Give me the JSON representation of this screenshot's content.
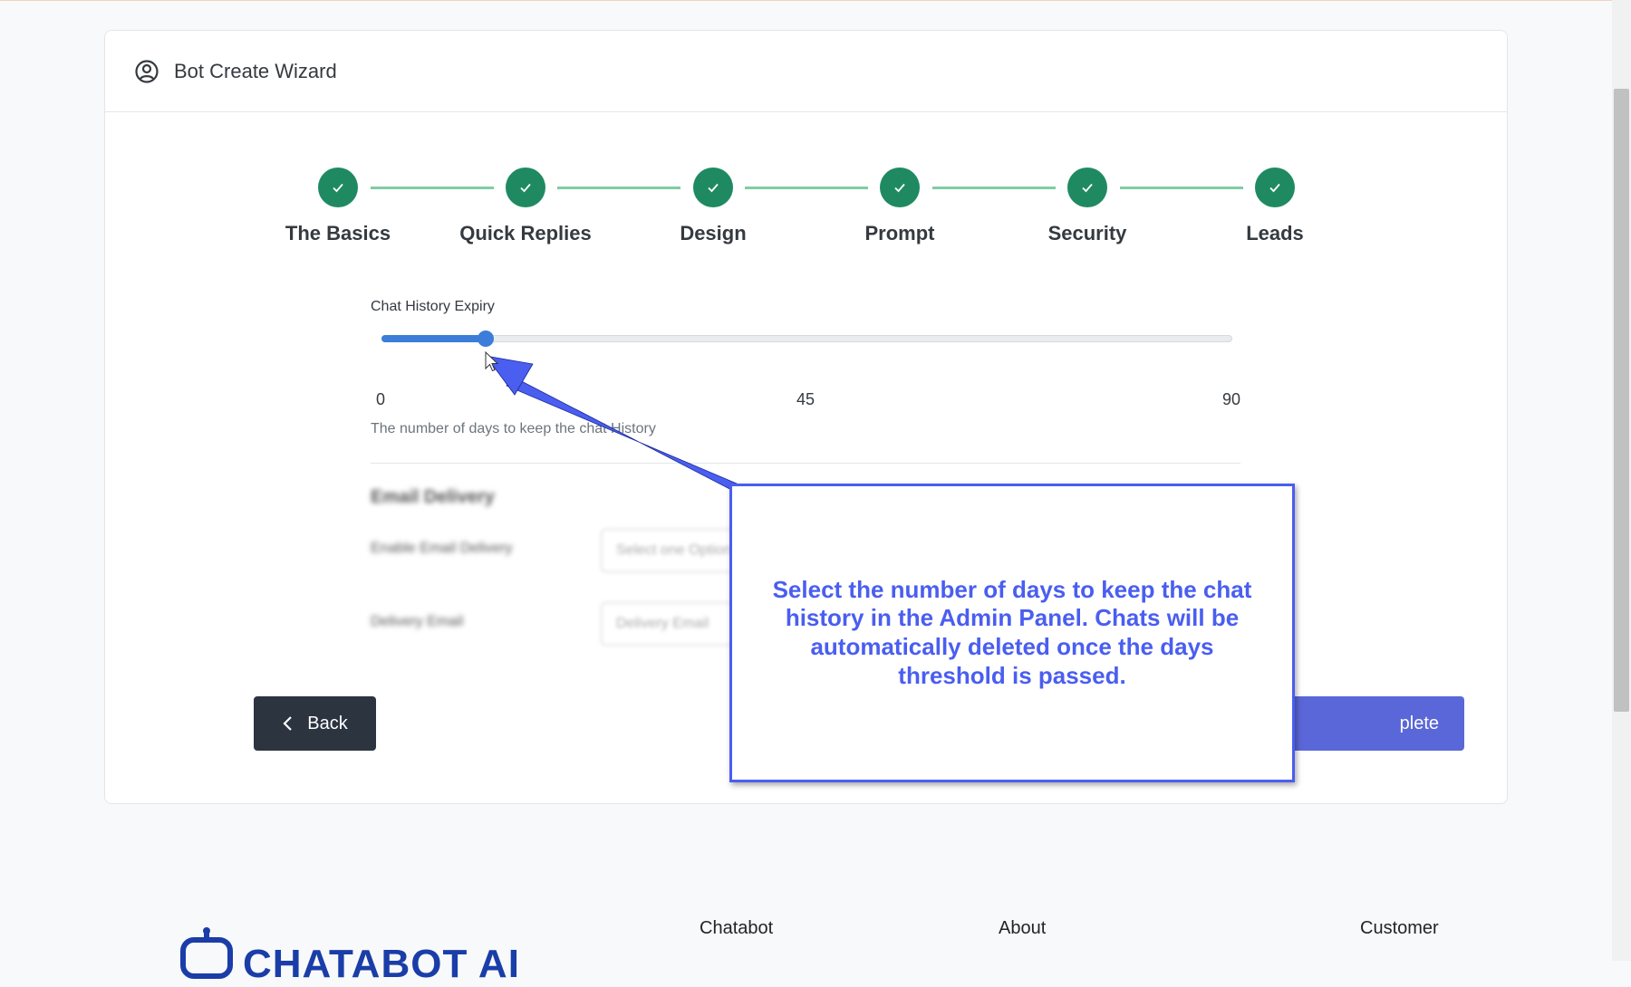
{
  "wizard": {
    "title": "Bot Create Wizard",
    "header_icon": "user-circle-icon"
  },
  "steps": [
    {
      "label": "The Basics",
      "status": "complete"
    },
    {
      "label": "Quick Replies",
      "status": "complete"
    },
    {
      "label": "Design",
      "status": "complete"
    },
    {
      "label": "Prompt",
      "status": "complete"
    },
    {
      "label": "Security",
      "status": "complete"
    },
    {
      "label": "Leads",
      "status": "complete"
    }
  ],
  "chat_history": {
    "label": "Chat History Expiry",
    "min": 0,
    "max": 90,
    "value": 11,
    "ticks": [
      "0",
      "45",
      "90"
    ],
    "help": "The number of days to keep the chat History"
  },
  "email_delivery": {
    "section_title": "Email Delivery",
    "enable_label": "Enable Email Delivery",
    "enable_placeholder": "Select one Option",
    "email_label": "Delivery Email",
    "email_placeholder": "Delivery Email"
  },
  "buttons": {
    "back": "Back",
    "complete": "plete"
  },
  "callout": {
    "text": "Select the number of days to keep the chat history in the Admin Panel. Chats will be automatically deleted once the days threshold is passed."
  },
  "footer": {
    "logo": "CHATABOT AI",
    "columns": [
      "Chatabot",
      "About",
      "Customer"
    ]
  },
  "colors": {
    "step_complete": "#1f8a62",
    "connector": "#7fcca4",
    "slider": "#3b7dd8",
    "callout": "#4a5ef0",
    "complete_button": "#5a67d8",
    "back_button": "#2c3440"
  }
}
